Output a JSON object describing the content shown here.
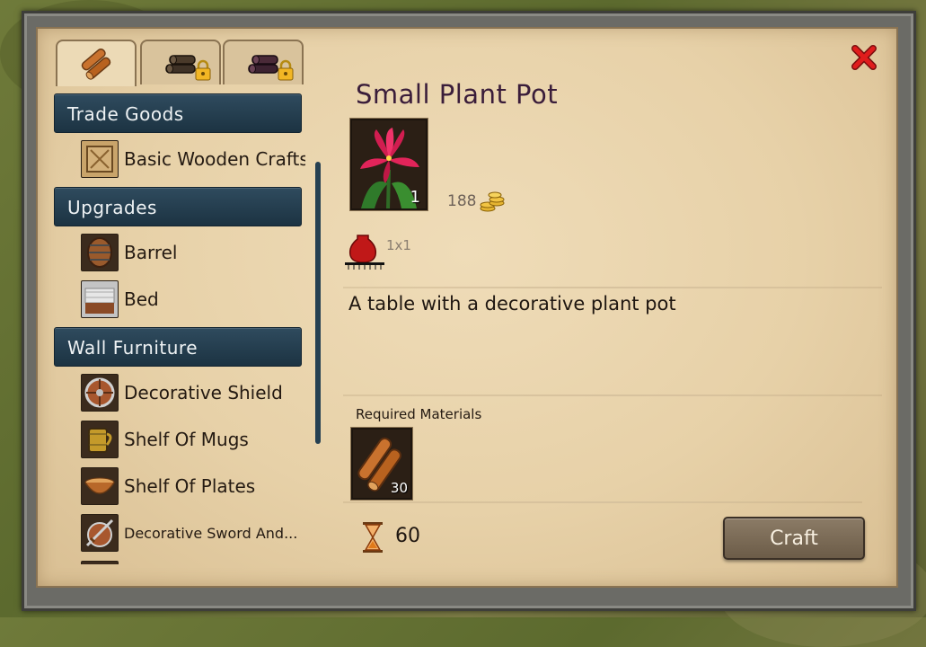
{
  "tabs": [
    {
      "icon": "wood-logs-icon",
      "locked": false,
      "color": "#c9722e"
    },
    {
      "icon": "dark-logs-icon",
      "locked": true,
      "color": "#4a3a2a"
    },
    {
      "icon": "purple-logs-icon",
      "locked": true,
      "color": "#4a2a38"
    }
  ],
  "sidebar": {
    "categories": [
      {
        "label": "Trade Goods",
        "items": [
          {
            "label": "Basic Wooden Crafts",
            "icon": "crate-icon"
          }
        ]
      },
      {
        "label": "Upgrades",
        "items": [
          {
            "label": "Barrel",
            "icon": "barrel-icon"
          },
          {
            "label": "Bed",
            "icon": "bed-icon"
          }
        ]
      },
      {
        "label": "Wall Furniture",
        "items": [
          {
            "label": "Decorative Shield",
            "icon": "shield-icon"
          },
          {
            "label": "Shelf Of Mugs",
            "icon": "mug-icon"
          },
          {
            "label": "Shelf Of Plates",
            "icon": "bowl-icon"
          },
          {
            "label": "Decorative Sword And...",
            "icon": "sword-shield-icon"
          }
        ]
      }
    ]
  },
  "detail": {
    "title": "Small Plant Pot",
    "item_icon": "lily-flower-icon",
    "quantity": "1",
    "price": "188",
    "price_icon": "gold-coins-icon",
    "size": "1x1",
    "size_icon": "red-vase-icon",
    "description": "A table with a decorative plant pot",
    "required_label": "Required Materials",
    "materials": [
      {
        "icon": "wood-logs-icon",
        "quantity": "30"
      }
    ],
    "craft_time": "60",
    "craft_time_icon": "hourglass-icon",
    "craft_label": "Craft"
  },
  "colors": {
    "header": "#1c3342",
    "parchment": "#e7d1a8",
    "title": "#3a1d3a",
    "close": "#e01c1c"
  }
}
